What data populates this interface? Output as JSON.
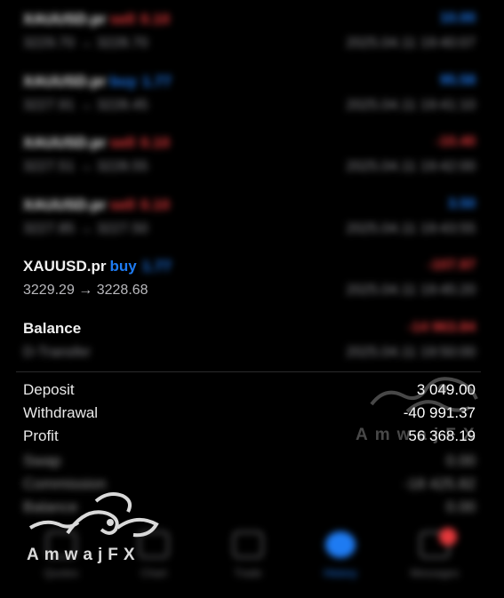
{
  "trades": [
    {
      "symbol": "XAUUSD.pr",
      "side": "sell",
      "lots": "0.10",
      "prices": "3229.70 → 3228.70",
      "profit": "10.00",
      "time": "2025.04.11 19:40:07"
    },
    {
      "symbol": "XAUUSD.pr",
      "side": "buy",
      "lots": "1.77",
      "prices": "3227.91 → 3228.45",
      "profit": "95.58",
      "time": "2025.04.11 19:41:10"
    },
    {
      "symbol": "XAUUSD.pr",
      "side": "sell",
      "lots": "0.10",
      "prices": "3227.51 → 3228.55",
      "profit": "-10.40",
      "time": "2025.04.11 19:42:00"
    },
    {
      "symbol": "XAUUSD.pr",
      "side": "sell",
      "lots": "0.10",
      "prices": "3227.85 → 3227.50",
      "profit": "3.50",
      "time": "2025.04.11 19:43:55"
    },
    {
      "symbol": "XAUUSD.pr",
      "side": "buy",
      "lots": "1.77",
      "prices": "3229.29 → 3228.68",
      "profit": "-107.97",
      "time": "2025.04.11 19:45:20"
    }
  ],
  "balance": {
    "label": "Balance",
    "sub": "D-Transfer",
    "amount": "-14 963.84",
    "time": "2025.04.11 19:50:00"
  },
  "summary": {
    "deposit_label": "Deposit",
    "deposit_value": "3 049.00",
    "withdrawal_label": "Withdrawal",
    "withdrawal_value": "-40 991.37",
    "profit_label": "Profit",
    "profit_value": "56 368.19",
    "swap_label": "Swap",
    "swap_value": "0.00",
    "commission_label": "Commission",
    "commission_value": "-18 425.82",
    "balance_label": "Balance",
    "balance_value": "0.00"
  },
  "tabs": [
    "Quotes",
    "Chart",
    "Trade",
    "History",
    "Messages"
  ],
  "watermark": {
    "brand": "AmwajFX",
    "brand_small": "AmwajFX"
  },
  "colors": {
    "buy": "#1e7bf2",
    "sell": "#e5383b",
    "background": "#000000"
  }
}
